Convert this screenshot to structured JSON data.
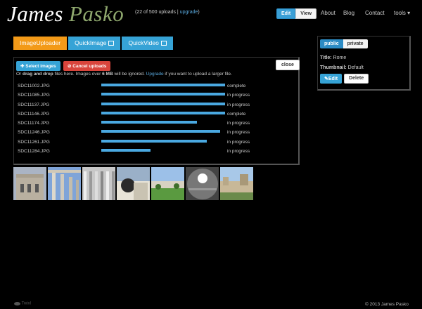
{
  "header": {
    "first_name": "James",
    "last_name": "Pasko",
    "uploads_text": "(22 of 500 uploads |",
    "upgrade_link": "upgrade",
    "uploads_close": ")",
    "edit_label": "Edit",
    "view_label": "View",
    "nav": [
      "About",
      "Blog",
      "Contact",
      "tools ▾"
    ]
  },
  "tabs": [
    {
      "label": "ImageUploader"
    },
    {
      "label": "QuickImage"
    },
    {
      "label": "QuickVideo"
    }
  ],
  "panel": {
    "select_label": "Select images",
    "cancel_label": "Cancel uploads",
    "close_label": "close",
    "drop_prefix": "Or",
    "drop_bold": "drag and drop",
    "drop_mid": "files here. Images over",
    "drop_size": "6 MB",
    "drop_after": "will be ignored.",
    "drop_link": "Upgrade",
    "drop_end": "if you want to upload a larger file."
  },
  "files": [
    {
      "name": "SDC11002.JPG",
      "progress": 100,
      "status": "complete"
    },
    {
      "name": "SDC11085.JPG",
      "progress": 100,
      "status": "in progress"
    },
    {
      "name": "SDC11137.JPG",
      "progress": 100,
      "status": "in progress"
    },
    {
      "name": "SDC11146.JPG",
      "progress": 100,
      "status": "complete"
    },
    {
      "name": "SDC11174.JPG",
      "progress": 77,
      "status": "in progress"
    },
    {
      "name": "SDC11246.JPG",
      "progress": 96,
      "status": "in progress"
    },
    {
      "name": "SDC11261.JPG",
      "progress": 85,
      "status": "in progress"
    },
    {
      "name": "SDC11284.JPG",
      "progress": 40,
      "status": "in progress"
    }
  ],
  "sidebar": {
    "public_label": "public",
    "private_label": "private",
    "title_label": "Title:",
    "title_value": "Rome",
    "thumb_label": "Thumbnail:",
    "thumb_value": "Default",
    "edit_label": "Edit",
    "delete_label": "Delete"
  },
  "footer": {
    "copyright": "© 2013 James Pasko",
    "logo_text": "Twixl"
  },
  "colors": {
    "accent_blue": "#36a3d6",
    "accent_orange": "#f39a18",
    "danger_red": "#d9453c",
    "progress_blue": "#4aa8e0"
  }
}
